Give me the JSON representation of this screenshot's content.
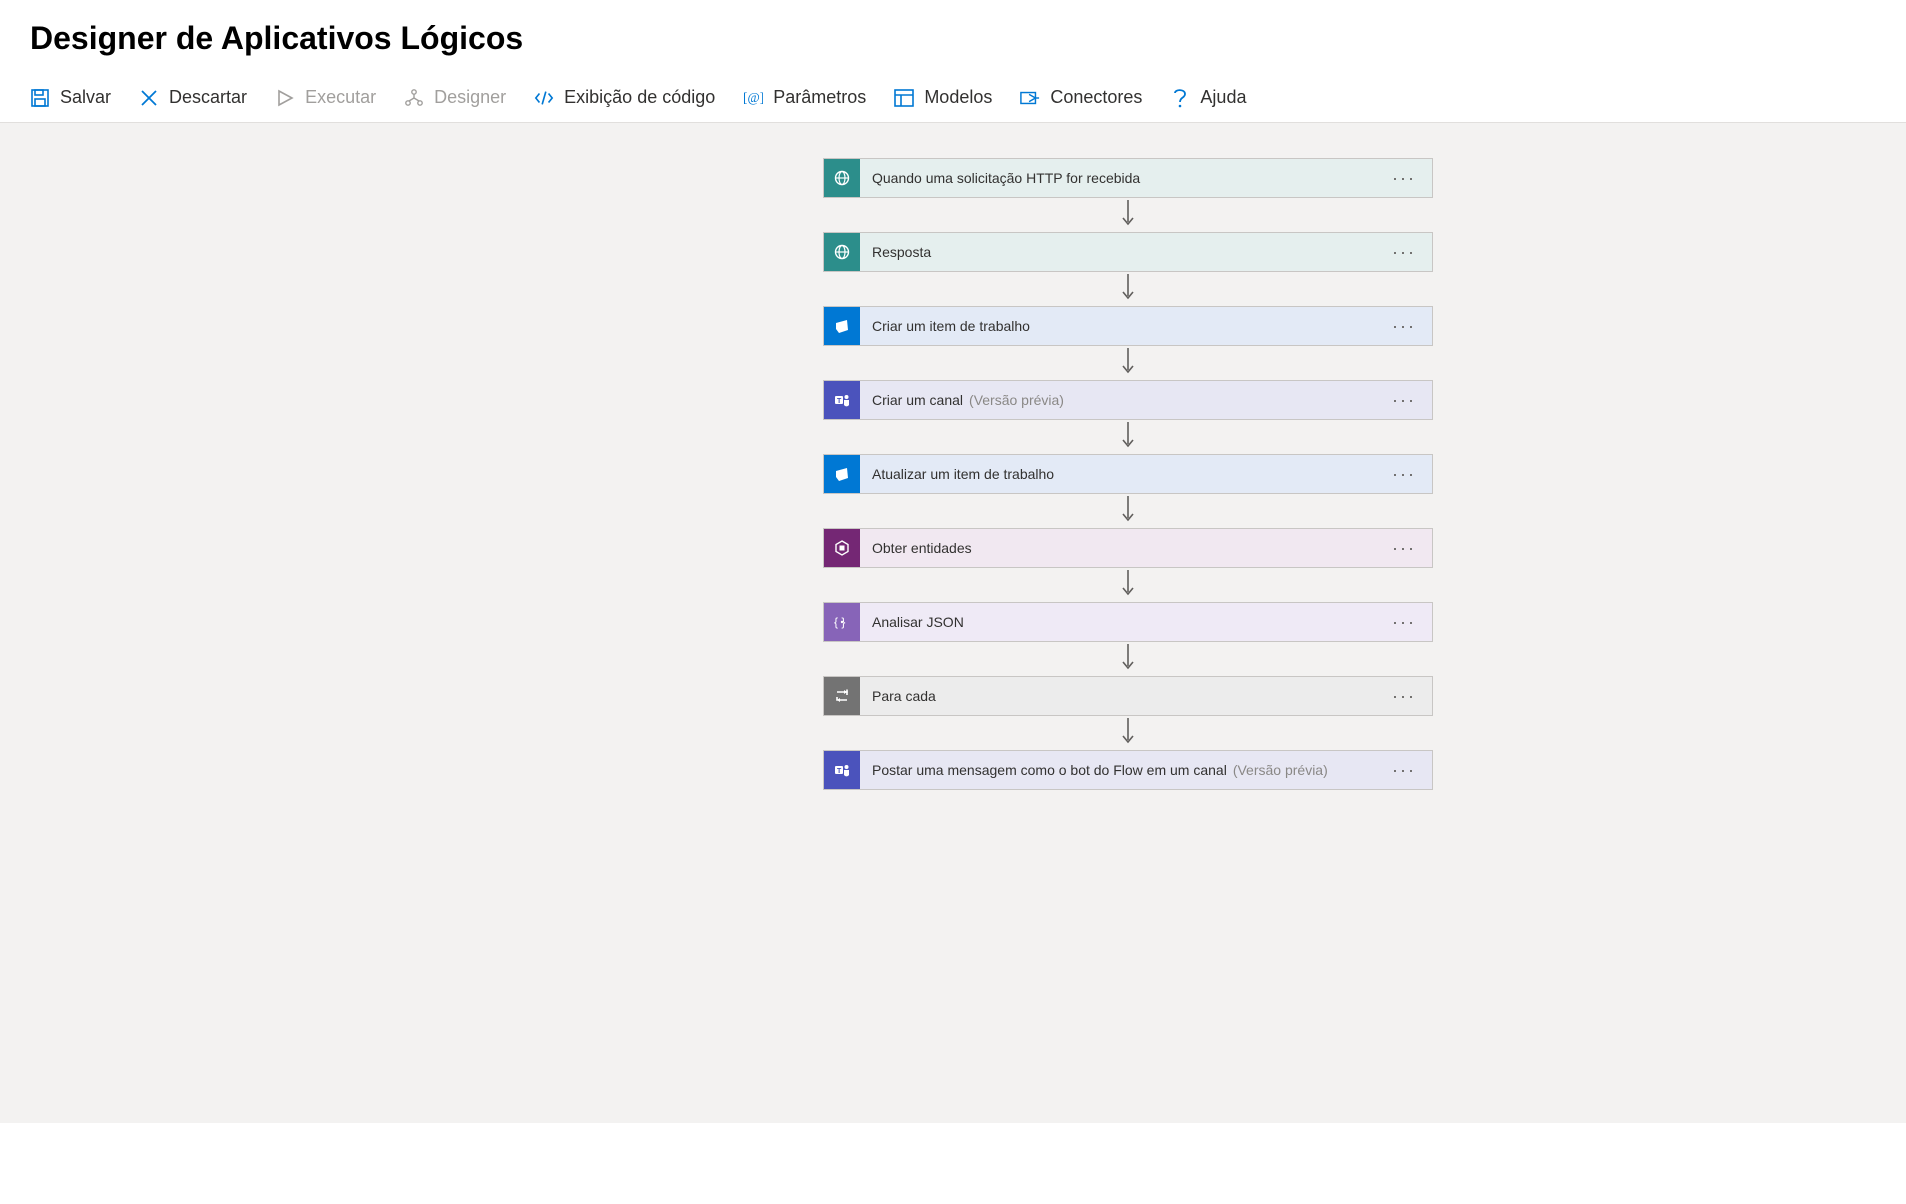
{
  "page": {
    "title": "Designer de Aplicativos Lógicos"
  },
  "toolbar": {
    "save": "Salvar",
    "discard": "Descartar",
    "run": "Executar",
    "designer": "Designer",
    "code_view": "Exibição de código",
    "parameters": "Parâmetros",
    "templates": "Modelos",
    "connectors": "Conectores",
    "help": "Ajuda"
  },
  "steps": [
    {
      "label": "Quando uma solicitação HTTP for recebida",
      "sub": "",
      "theme": "teal",
      "icon": "http-request-icon"
    },
    {
      "label": "Resposta",
      "sub": "",
      "theme": "teal",
      "icon": "http-response-icon"
    },
    {
      "label": "Criar um item de trabalho",
      "sub": "",
      "theme": "devops",
      "icon": "azure-devops-icon"
    },
    {
      "label": "Criar um canal",
      "sub": "(Versão prévia)",
      "theme": "teams",
      "icon": "teams-icon"
    },
    {
      "label": "Atualizar um item de trabalho",
      "sub": "",
      "theme": "devops",
      "icon": "azure-devops-icon"
    },
    {
      "label": "Obter entidades",
      "sub": "",
      "theme": "luis",
      "icon": "luis-icon"
    },
    {
      "label": "Analisar JSON",
      "sub": "",
      "theme": "json",
      "icon": "json-icon"
    },
    {
      "label": "Para cada",
      "sub": "",
      "theme": "control",
      "icon": "foreach-icon"
    },
    {
      "label": "Postar uma mensagem como o bot do Flow em um canal",
      "sub": "(Versão prévia)",
      "theme": "teams",
      "icon": "teams-icon"
    }
  ],
  "colors": {
    "accent_blue": "#0078d4",
    "canvas_bg": "#f3f2f1"
  }
}
